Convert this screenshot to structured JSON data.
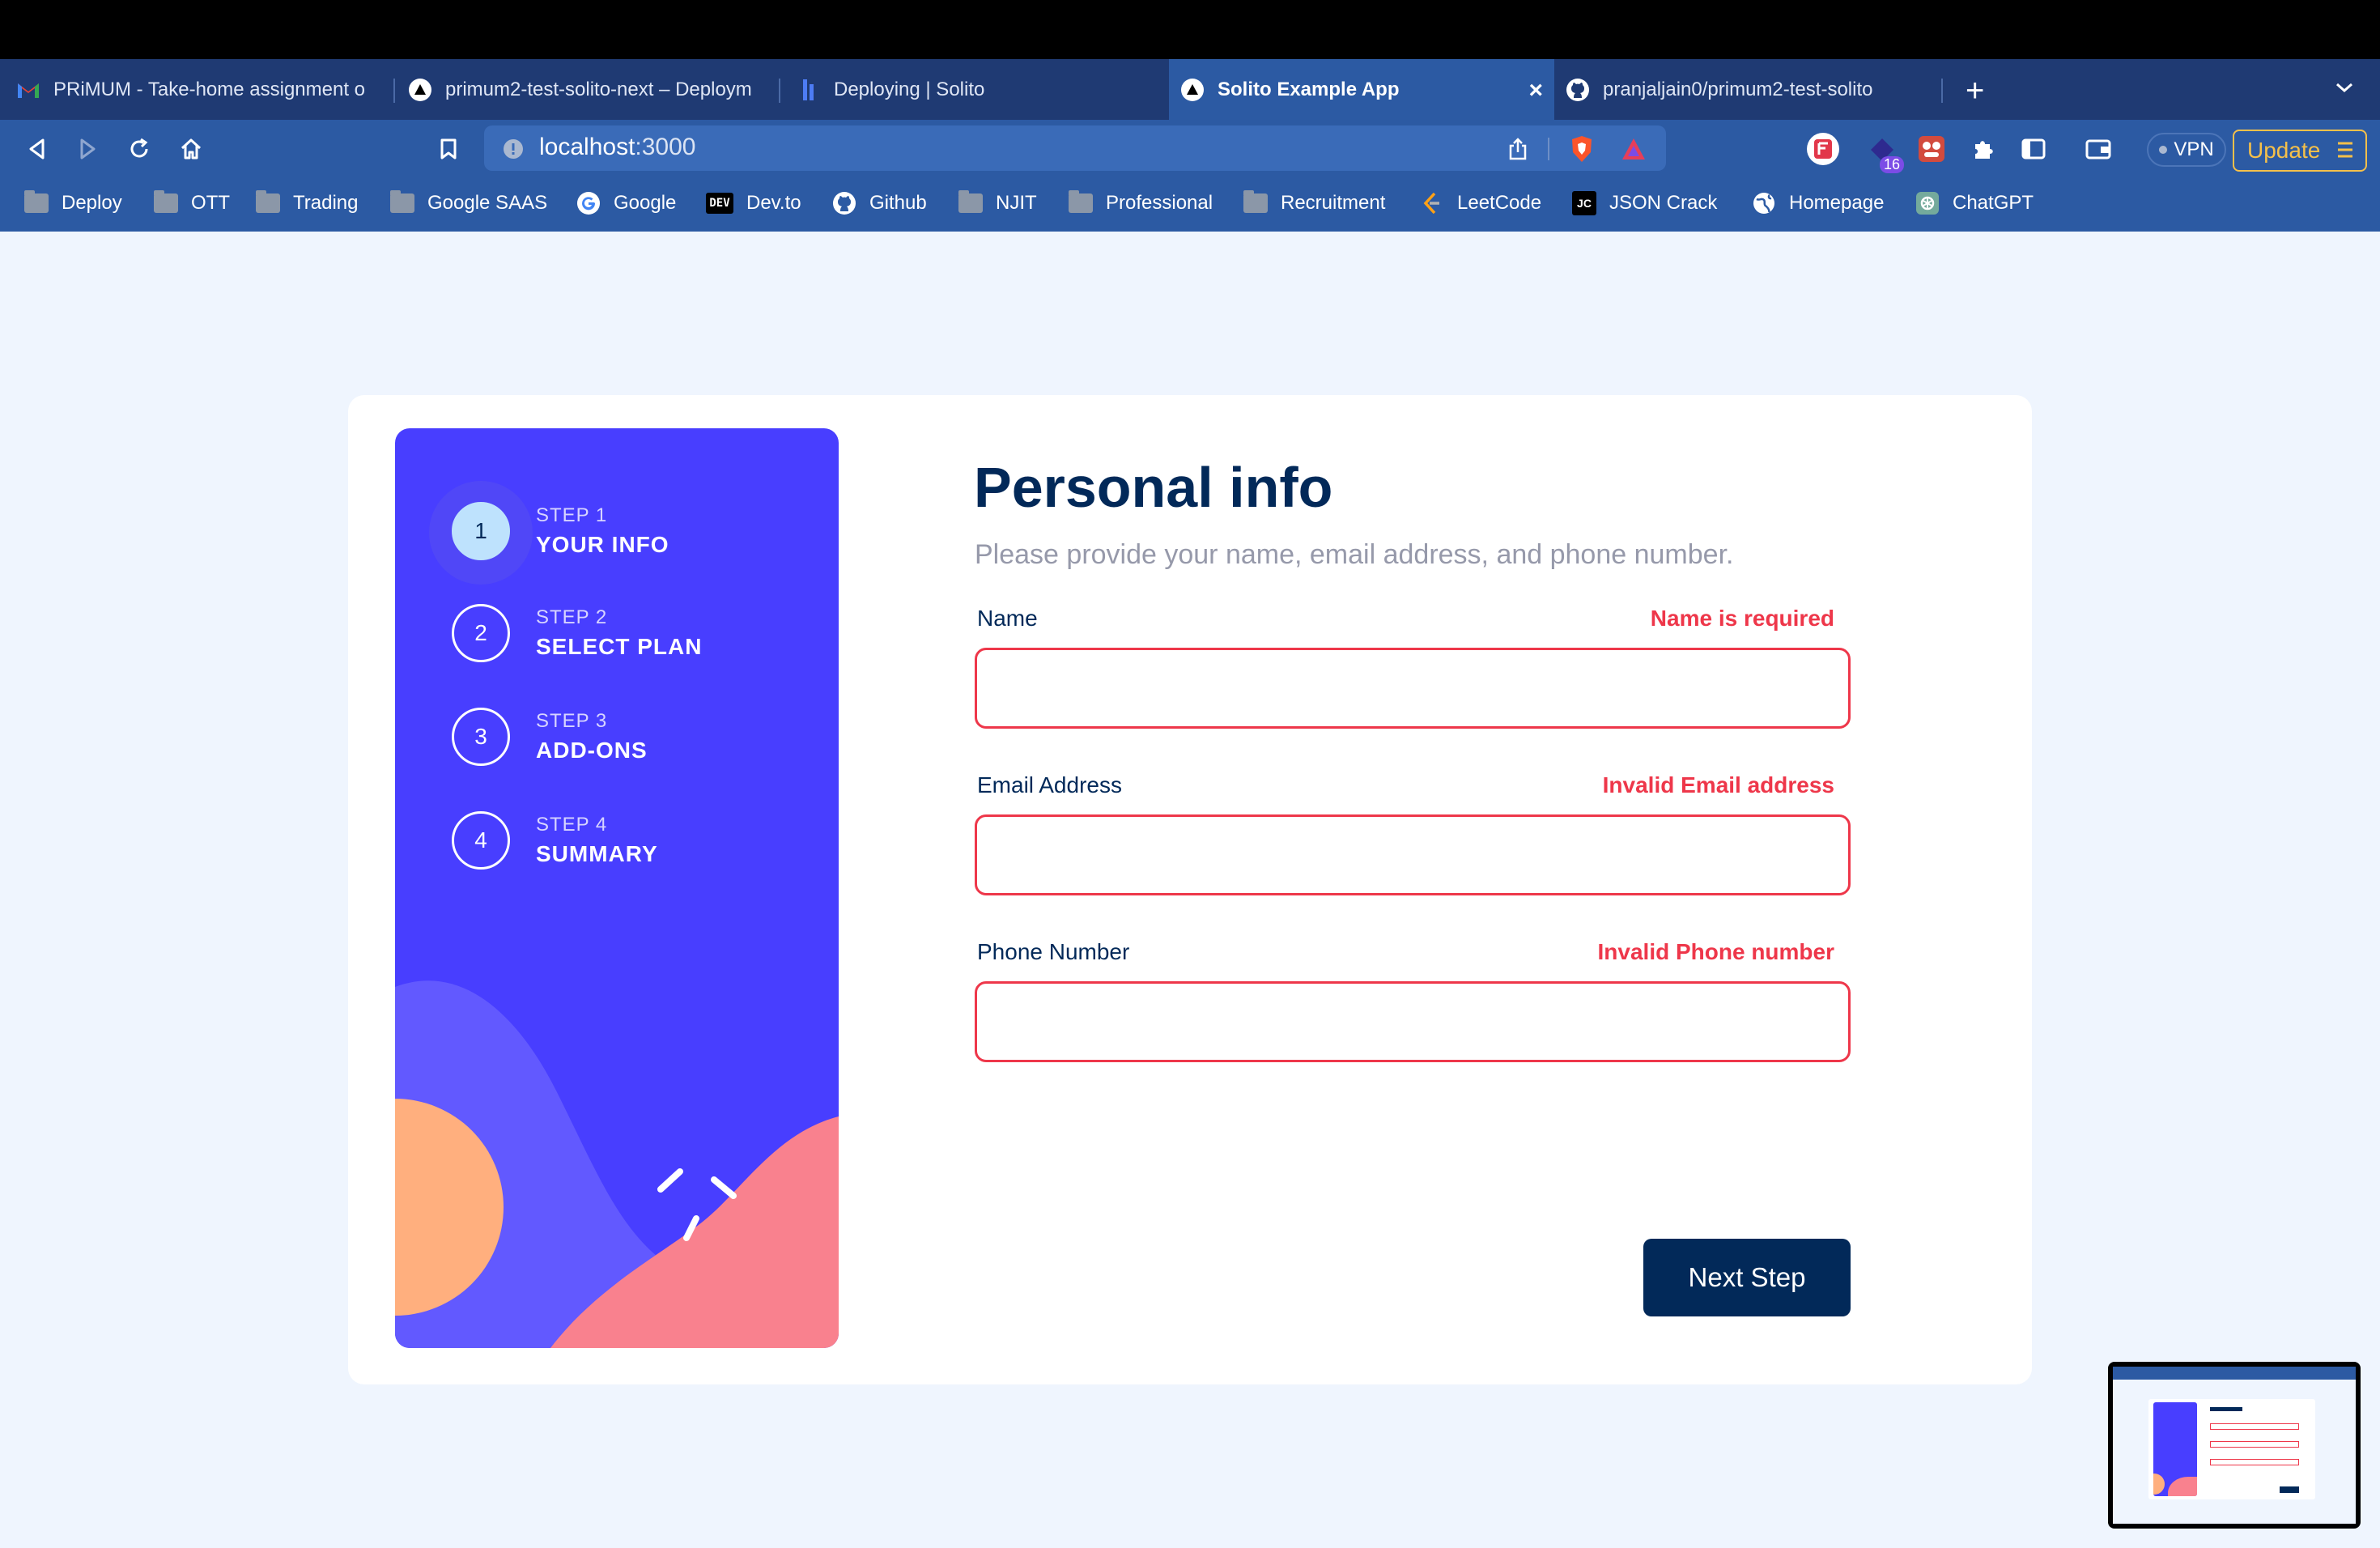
{
  "browser": {
    "tabs": [
      {
        "title": "PRiMUM - Take-home assignment o",
        "icon": "gmail-icon",
        "active": false
      },
      {
        "title": "primum2-test-solito-next – Deploym",
        "icon": "vercel-icon",
        "active": false
      },
      {
        "title": "Deploying | Solito",
        "icon": "solito-icon",
        "active": false
      },
      {
        "title": "Solito Example App",
        "icon": "vercel-icon",
        "active": true
      },
      {
        "title": "pranjaljain0/primum2-test-solito",
        "icon": "github-icon",
        "active": false
      }
    ],
    "url": {
      "host": "localhost",
      "port": ":3000"
    },
    "vpn_label": "VPN",
    "update_label": "Update",
    "extension_badge": "16",
    "bookmarks": [
      {
        "label": "Deploy",
        "icon": "folder-icon"
      },
      {
        "label": "OTT",
        "icon": "folder-icon"
      },
      {
        "label": "Trading",
        "icon": "folder-icon"
      },
      {
        "label": "Google SAAS",
        "icon": "folder-icon"
      },
      {
        "label": "Google",
        "icon": "google-icon"
      },
      {
        "label": "Dev.to",
        "icon": "devto-icon"
      },
      {
        "label": "Github",
        "icon": "github-icon"
      },
      {
        "label": "NJIT",
        "icon": "folder-icon"
      },
      {
        "label": "Professional",
        "icon": "folder-icon"
      },
      {
        "label": "Recruitment",
        "icon": "folder-icon"
      },
      {
        "label": "LeetCode",
        "icon": "leetcode-icon"
      },
      {
        "label": "JSON Crack",
        "icon": "jsoncrack-icon"
      },
      {
        "label": "Homepage",
        "icon": "globe-icon"
      },
      {
        "label": "ChatGPT",
        "icon": "chatgpt-icon"
      }
    ],
    "devto_glyph": "DEV",
    "jsoncrack_glyph": "JC"
  },
  "steps": [
    {
      "number": "1",
      "step_label": "STEP 1",
      "name": "YOUR INFO",
      "active": true
    },
    {
      "number": "2",
      "step_label": "STEP 2",
      "name": "SELECT PLAN",
      "active": false
    },
    {
      "number": "3",
      "step_label": "STEP 3",
      "name": "ADD-ONS",
      "active": false
    },
    {
      "number": "4",
      "step_label": "STEP 4",
      "name": "SUMMARY",
      "active": false
    }
  ],
  "form": {
    "title": "Personal info",
    "subtitle": "Please provide your name, email address, and phone number.",
    "fields": [
      {
        "label": "Name",
        "error": "Name is required",
        "value": "",
        "placeholder": ""
      },
      {
        "label": "Email Address",
        "error": "Invalid Email address",
        "value": "",
        "placeholder": ""
      },
      {
        "label": "Phone Number",
        "error": "Invalid Phone number",
        "value": "",
        "placeholder": ""
      }
    ],
    "next_label": "Next Step"
  },
  "colors": {
    "sidebar": "#483eff",
    "error": "#ee374a",
    "marine": "#022959",
    "active_step": "#bee2fd"
  }
}
